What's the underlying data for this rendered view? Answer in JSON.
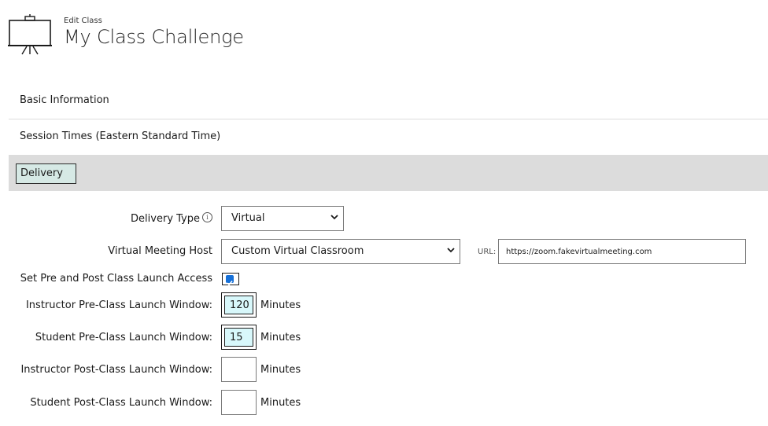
{
  "header": {
    "subtitle": "Edit Class",
    "title": "My Class Challenge",
    "icon": "presentation-board-icon"
  },
  "sections": {
    "basic": "Basic Information",
    "session": "Session Times (Eastern Standard Time)",
    "delivery": "Delivery"
  },
  "form": {
    "delivery_type": {
      "label": "Delivery Type",
      "value": "Virtual",
      "info_icon": "info-icon"
    },
    "meeting_host": {
      "label": "Virtual Meeting Host",
      "value": "Custom Virtual Classroom"
    },
    "url": {
      "label": "URL:",
      "value": "https://zoom.fakevirtualmeeting.com"
    },
    "launch_access": {
      "label": "Set Pre and Post Class Launch Access",
      "checked": true
    },
    "instructor_pre": {
      "label": "Instructor Pre-Class Launch Window:",
      "value": "120",
      "unit": "Minutes"
    },
    "student_pre": {
      "label": "Student Pre-Class Launch Window:",
      "value": "15",
      "unit": "Minutes"
    },
    "instructor_post": {
      "label": "Instructor Post-Class Launch Window:",
      "value": "",
      "unit": "Minutes"
    },
    "student_post": {
      "label": "Student Post-Class Launch Window:",
      "value": "",
      "unit": "Minutes"
    }
  },
  "colors": {
    "delivery_bar": "#dcdcdc",
    "delivery_tab": "#d6e9e5",
    "active_input": "#d8f8fb",
    "checkbox": "#1670d8"
  }
}
